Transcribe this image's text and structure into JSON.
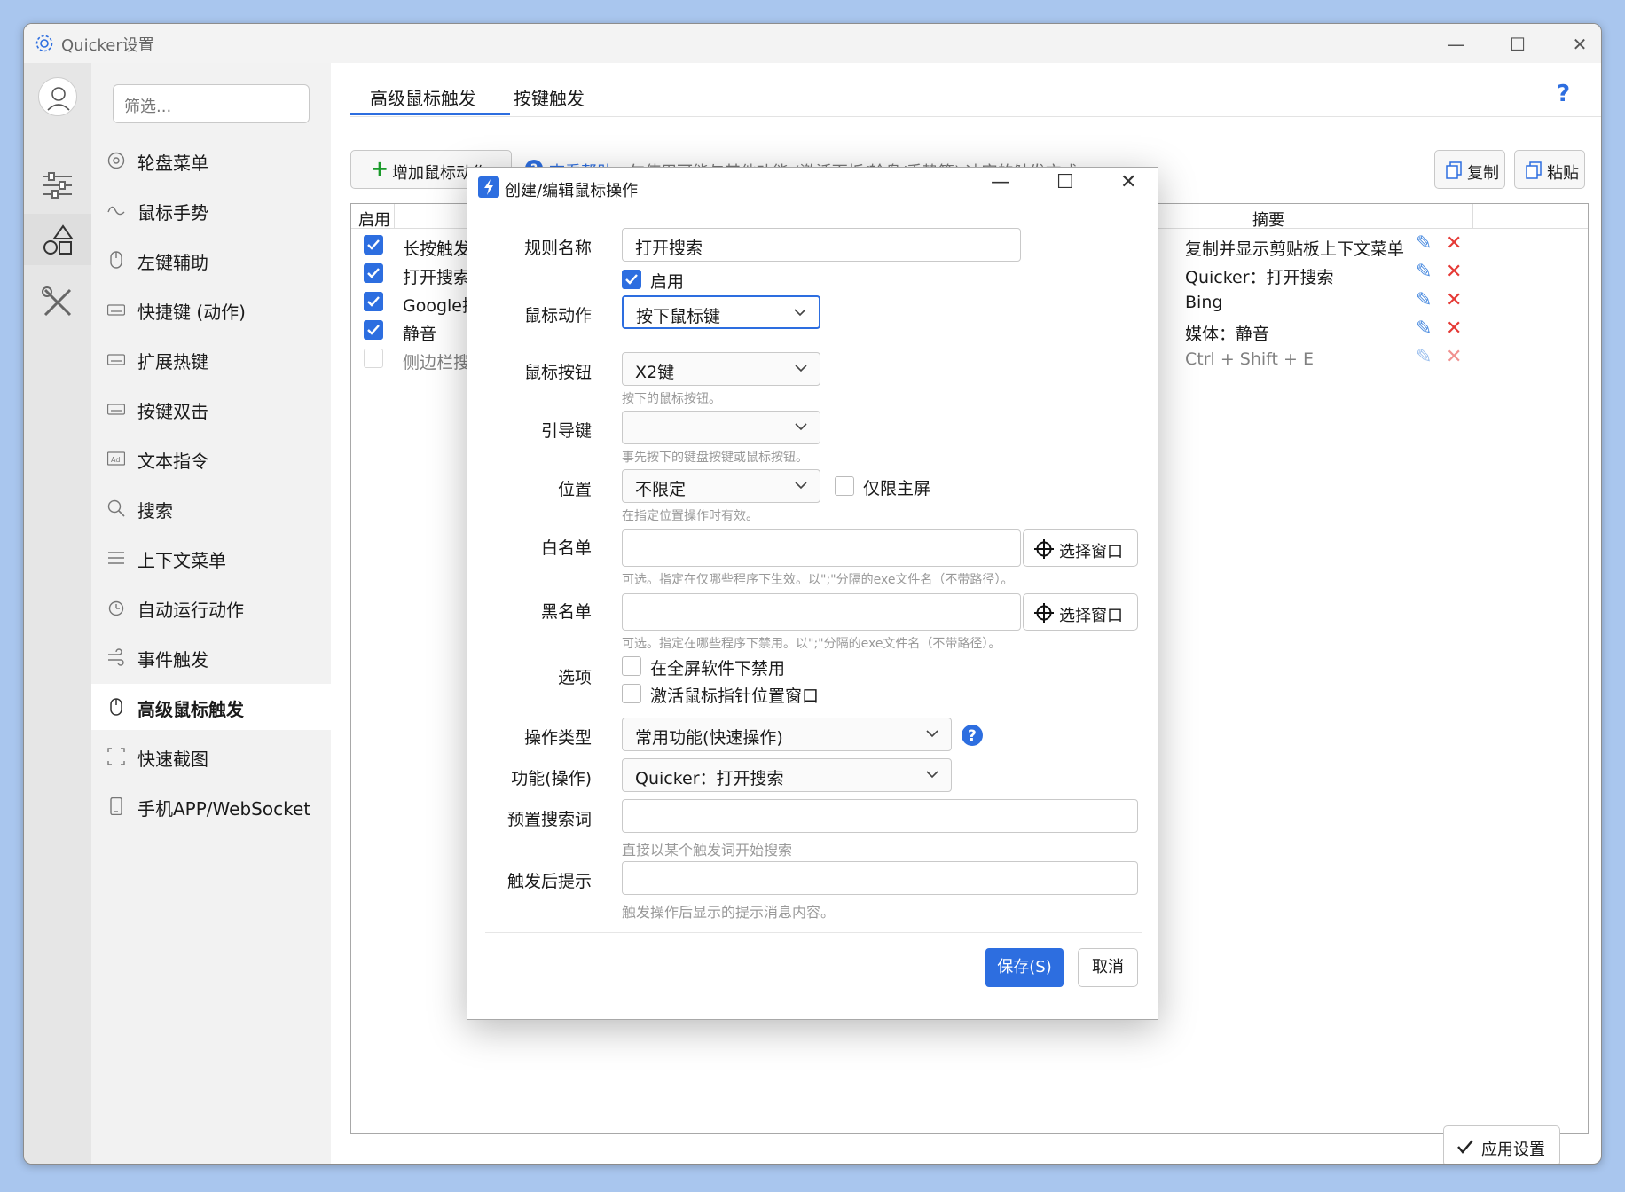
{
  "window": {
    "title": "Quicker设置",
    "controls": {
      "minimize": "—",
      "maximize": "☐",
      "close": "✕"
    }
  },
  "sidebar": {
    "filter_placeholder": "筛选...",
    "items": [
      {
        "label": "轮盘菜单",
        "icon": "wheel-icon"
      },
      {
        "label": "鼠标手势",
        "icon": "gesture-icon"
      },
      {
        "label": "左键辅助",
        "icon": "mouse-icon"
      },
      {
        "label": "快捷键 (动作)",
        "icon": "keyboard-icon"
      },
      {
        "label": "扩展热键",
        "icon": "keyboard-icon"
      },
      {
        "label": "按键双击",
        "icon": "keyboard-icon"
      },
      {
        "label": "文本指令",
        "icon": "ad-icon"
      },
      {
        "label": "搜索",
        "icon": "search-icon"
      },
      {
        "label": "上下文菜单",
        "icon": "menu-icon"
      },
      {
        "label": "自动运行动作",
        "icon": "alarm-icon"
      },
      {
        "label": "事件触发",
        "icon": "wind-icon"
      },
      {
        "label": "高级鼠标触发",
        "icon": "mouse-icon",
        "active": true
      },
      {
        "label": "快速截图",
        "icon": "screenshot-icon"
      },
      {
        "label": "手机APP/WebSocket",
        "icon": "phone-icon"
      }
    ]
  },
  "tabs": [
    {
      "label": "高级鼠标触发",
      "active": true
    },
    {
      "label": "按键触发"
    }
  ],
  "help_mark": "?",
  "toolbar": {
    "add_label": "增加鼠标动作",
    "help_link": "查看帮助",
    "help_text": "勿使用可能与其他功能 (激活面板/轮盘/手势等) 冲突的触发方式。",
    "copy_label": "复制",
    "paste_label": "粘贴"
  },
  "table": {
    "headers": {
      "enabled": "启用",
      "summary": "摘要"
    },
    "rows": [
      {
        "enabled": true,
        "name": "长按触发",
        "summary": "复制并显示剪贴板上下文菜单"
      },
      {
        "enabled": true,
        "name": "打开搜索",
        "summary": "Quicker：打开搜索"
      },
      {
        "enabled": true,
        "name": "Google搜",
        "summary": "Bing"
      },
      {
        "enabled": true,
        "name": "静音",
        "summary": "媒体：静音"
      },
      {
        "enabled": false,
        "name": "侧边栏搜",
        "summary": "Ctrl + Shift + E"
      }
    ]
  },
  "apply_label": "应用设置",
  "dialog": {
    "title": "创建/编辑鼠标操作",
    "rule_name": {
      "label": "规则名称",
      "value": "打开搜索"
    },
    "enabled_label": "启用",
    "mouse_action": {
      "label": "鼠标动作",
      "value": "按下鼠标键"
    },
    "mouse_button": {
      "label": "鼠标按钮",
      "value": "X2键",
      "hint": "按下的鼠标按钮。"
    },
    "lead_key": {
      "label": "引导键",
      "value": "",
      "hint": "事先按下的键盘按键或鼠标按钮。"
    },
    "position": {
      "label": "位置",
      "value": "不限定",
      "primary_only": "仅限主屏",
      "hint": "在指定位置操作时有效。"
    },
    "whitelist": {
      "label": "白名单",
      "value": "",
      "select_label": "选择窗口",
      "hint": "可选。指定在仅哪些程序下生效。以\";\"分隔的exe文件名（不带路径）。"
    },
    "blacklist": {
      "label": "黑名单",
      "value": "",
      "select_label": "选择窗口",
      "hint": "可选。指定在哪些程序下禁用。以\";\"分隔的exe文件名（不带路径）。"
    },
    "options": {
      "label": "选项",
      "fullscreen_disable": "在全屏软件下禁用",
      "activate_window": "激活鼠标指针位置窗口"
    },
    "op_type": {
      "label": "操作类型",
      "value": "常用功能(快速操作)"
    },
    "function": {
      "label": "功能(操作)",
      "value": "Quicker：打开搜索"
    },
    "preset_word": {
      "label": "预置搜索词",
      "value": "",
      "hint": "直接以某个触发词开始搜索"
    },
    "after_tip": {
      "label": "触发后提示",
      "value": "",
      "hint": "触发操作后显示的提示消息内容。"
    },
    "save_label": "保存(S)",
    "cancel_label": "取消"
  },
  "colors": {
    "accent": "#2d6ee0",
    "delete": "#e53935",
    "edit": "#4a8be0"
  }
}
